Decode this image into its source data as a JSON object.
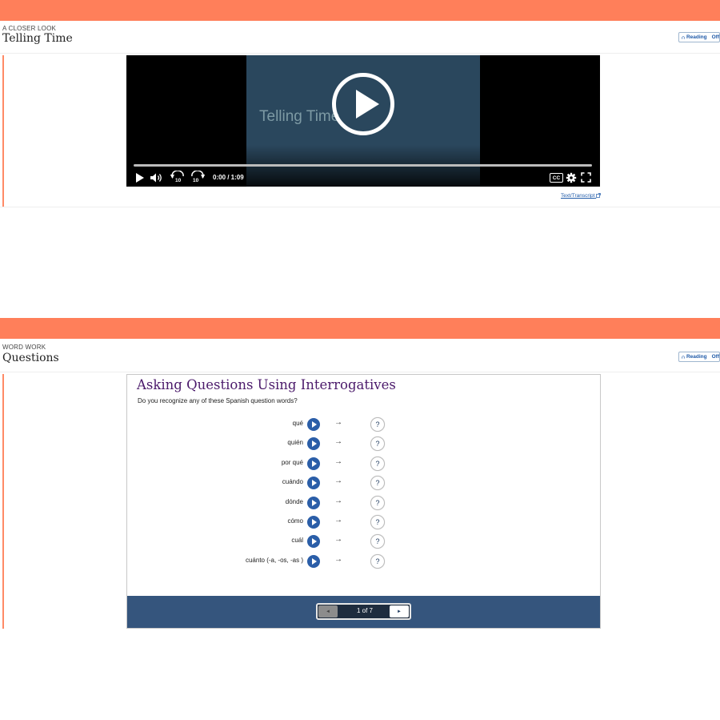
{
  "section1": {
    "kicker": "A CLOSER LOOK",
    "title": "Telling Time",
    "reading_label": "Reading",
    "reading_state": "Off"
  },
  "video": {
    "slide_title": "Telling Time",
    "time": "0:00 / 1:09",
    "cc_label": "CC",
    "skip_back_label": "10",
    "skip_forward_label": "10",
    "transcript_link": "Text/Transcript"
  },
  "section2": {
    "kicker": "WORD WORK",
    "title": "Questions",
    "reading_label": "Reading",
    "reading_state": "Off"
  },
  "activity": {
    "title": "Asking Questions Using Interrogatives",
    "subtitle": "Do you recognize any of these Spanish question words?",
    "arrow": "→",
    "answer_placeholder": "?",
    "words": [
      "qué",
      "quién",
      "por qué",
      "cuándo",
      "dónde",
      "cómo",
      "cuál",
      "cuánto (-a, -os, -as )"
    ],
    "pager": {
      "label": "1 of 7",
      "prev": "◄",
      "next": "►"
    }
  },
  "colors": {
    "band": "#ff7f5a",
    "title_purple": "#4b1a6b",
    "play_blue": "#2b5ea8",
    "pager_bar": "#35557d"
  }
}
